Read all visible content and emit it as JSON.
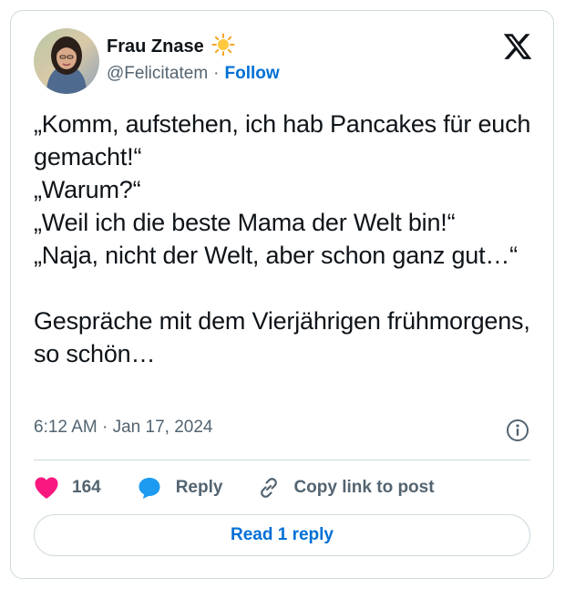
{
  "author": {
    "name": "Frau Znase",
    "name_emoji_icon": "sun-icon",
    "handle": "@Felicitatem",
    "separator": "·",
    "follow_label": "Follow"
  },
  "platform_icon": "x-logo-icon",
  "post": {
    "text": "„Komm, aufstehen, ich hab Pancakes für euch gemacht!“\n„Warum?“\n„Weil ich die beste Mama der Welt bin!“\n„Naja, nicht der Welt, aber schon ganz gut…“\n\nGespräche mit dem Vierjährigen frühmorgens, so schön…",
    "timestamp": "6:12 AM · Jan 17, 2024"
  },
  "actions": {
    "like_count": "164",
    "reply_label": "Reply",
    "copy_label": "Copy link to post"
  },
  "read_replies_label": "Read 1 reply",
  "colors": {
    "accent": "#006fd6",
    "like": "#f91880",
    "reply": "#1d9bf0",
    "muted": "#536471",
    "border": "#cfd9de"
  }
}
